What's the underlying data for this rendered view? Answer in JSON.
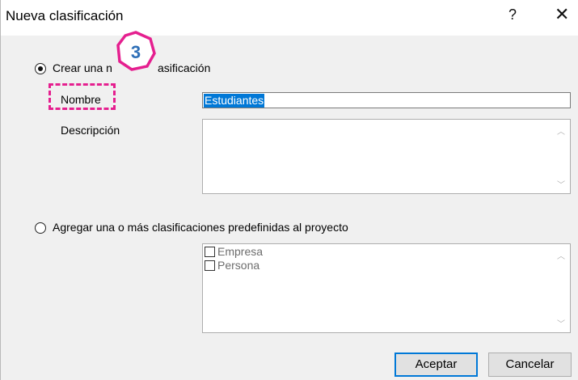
{
  "window": {
    "title": "Nueva clasificación",
    "help_glyph": "?",
    "close_glyph": "✕"
  },
  "create": {
    "radio_label": "Crear una nueva clasificación",
    "radio_visible_prefix": "Crear una n",
    "radio_visible_suffix": "asificación",
    "selected": true,
    "name_label": "Nombre",
    "name_value": "Estudiantes",
    "description_label": "Descripción",
    "description_value": ""
  },
  "predefined": {
    "radio_label": "Agregar una o más clasificaciones predefinidas al proyecto",
    "selected": false,
    "items": [
      {
        "label": "Empresa",
        "checked": false
      },
      {
        "label": "Persona",
        "checked": false
      }
    ]
  },
  "buttons": {
    "ok": "Aceptar",
    "cancel": "Cancelar"
  },
  "callout": {
    "step_number": "3",
    "color": "#e51f8f"
  },
  "colors": {
    "selection": "#0078d7",
    "dialog_bg": "#f0f0f0"
  }
}
